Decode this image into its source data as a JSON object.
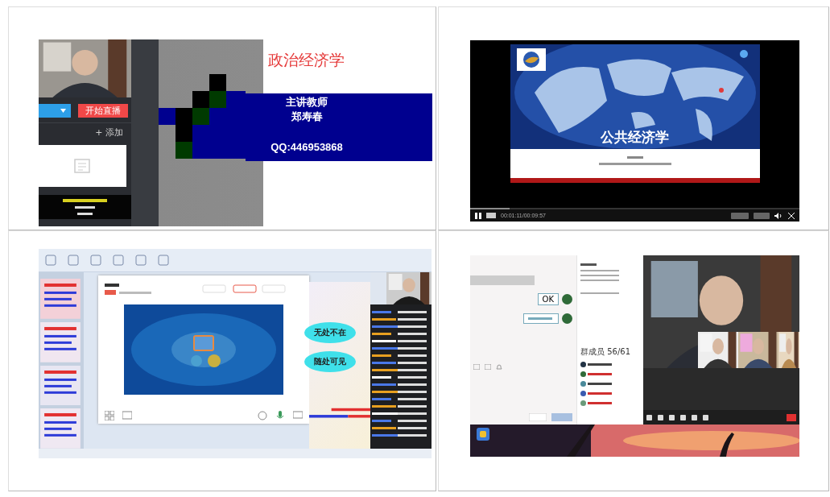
{
  "panels": [
    {
      "kind": "live_stream",
      "start_button": "开始直播",
      "add_link": "+ 添加",
      "slide": {
        "title": "政治经济学",
        "role": "主讲教师",
        "teacher": "郑寿春",
        "contact": "QQ:446953868"
      }
    },
    {
      "kind": "video_player",
      "slide_title": "公共经济学",
      "time": "00:01:11/00:09:57",
      "progress": {
        "level": 0.12
      }
    },
    {
      "kind": "screen_share",
      "bubbles": [
        "无处不在",
        "随处可见"
      ]
    },
    {
      "kind": "group_chat",
      "messages": [
        "OK"
      ],
      "member_count": "群成员 56/61"
    }
  ]
}
